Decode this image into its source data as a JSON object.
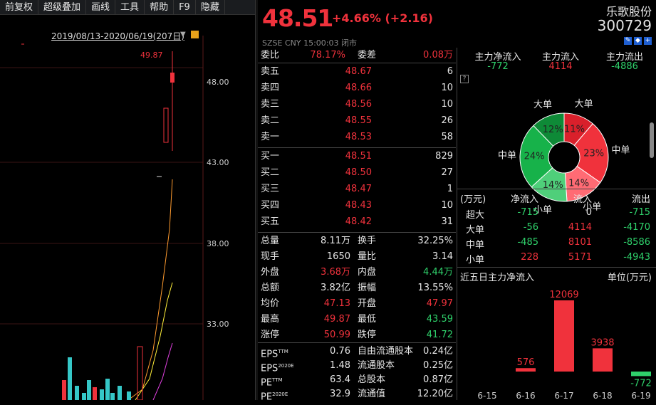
{
  "toolbar": {
    "items": [
      "前复权",
      "超级叠加",
      "画线",
      "工具",
      "帮助",
      "F9",
      "隐藏"
    ]
  },
  "kline": {
    "range": "2019/08/13-2020/06/19(207日)",
    "peak": "49.87",
    "axis": [
      "48.00",
      "43.00",
      "38.00",
      "33.00"
    ]
  },
  "header": {
    "price": "48.51",
    "change": "+4.66% (+2.16)",
    "name": "乐歌股份",
    "code": "300729",
    "sub": "SZSE  CNY  15:00:03  闭市"
  },
  "ratio": {
    "wb_label": "委比",
    "wb_value": "78.17%",
    "wc_label": "委差",
    "wc_value": "0.08万"
  },
  "asks": [
    {
      "label": "卖五",
      "price": "48.67",
      "vol": "6"
    },
    {
      "label": "卖四",
      "price": "48.66",
      "vol": "10"
    },
    {
      "label": "卖三",
      "price": "48.56",
      "vol": "10"
    },
    {
      "label": "卖二",
      "price": "48.55",
      "vol": "26"
    },
    {
      "label": "卖一",
      "price": "48.53",
      "vol": "58"
    }
  ],
  "bids": [
    {
      "label": "买一",
      "price": "48.51",
      "vol": "829"
    },
    {
      "label": "买二",
      "price": "48.50",
      "vol": "27"
    },
    {
      "label": "买三",
      "price": "48.47",
      "vol": "1"
    },
    {
      "label": "买四",
      "price": "48.43",
      "vol": "10"
    },
    {
      "label": "买五",
      "price": "48.42",
      "vol": "31"
    }
  ],
  "stats": [
    {
      "l1": "总量",
      "v1": "8.11万",
      "l2": "换手",
      "v2": "32.25%",
      "c1": "white",
      "c2": "white"
    },
    {
      "l1": "现手",
      "v1": "1650",
      "l2": "量比",
      "v2": "3.14",
      "c1": "white",
      "c2": "white"
    },
    {
      "l1": "外盘",
      "v1": "3.68万",
      "l2": "内盘",
      "v2": "4.44万",
      "c1": "red",
      "c2": "green"
    },
    {
      "l1": "总额",
      "v1": "3.82亿",
      "l2": "振幅",
      "v2": "13.55%",
      "c1": "white",
      "c2": "white"
    },
    {
      "l1": "均价",
      "v1": "47.13",
      "l2": "开盘",
      "v2": "47.97",
      "c1": "red",
      "c2": "red"
    },
    {
      "l1": "最高",
      "v1": "49.87",
      "l2": "最低",
      "v2": "43.59",
      "c1": "red",
      "c2": "green"
    },
    {
      "l1": "涨停",
      "v1": "50.99",
      "l2": "跌停",
      "v2": "41.72",
      "c1": "red",
      "c2": "green"
    }
  ],
  "fin": [
    {
      "l1": "EPS",
      "s1": "TTM",
      "v1": "0.76",
      "l2": "自由流通股本",
      "v2": "0.24亿"
    },
    {
      "l1": "EPS",
      "s1": "2020E",
      "v1": "1.48",
      "l2": "流通股本",
      "v2": "0.25亿"
    },
    {
      "l1": "PE",
      "s1": "TTM",
      "v1": "63.4",
      "l2": "总股本",
      "v2": "0.87亿"
    },
    {
      "l1": "PE",
      "s1": "2020E",
      "v1": "32.9",
      "l2": "流通值",
      "v2": "12.20亿"
    }
  ],
  "mainflow": {
    "labels": [
      "主力净流入",
      "主力流入",
      "主力流出"
    ],
    "values": [
      "-772",
      "4114",
      "-4886"
    ]
  },
  "pie": {
    "slices": [
      {
        "label": "大单",
        "pct": "11%",
        "value": 11,
        "color": "#d9202b"
      },
      {
        "label": "中单",
        "pct": "23%",
        "value": 23,
        "color": "#f0323c"
      },
      {
        "label": "小单",
        "pct": "14%",
        "value": 14,
        "color": "#ff6b74"
      },
      {
        "label": "小单",
        "pct": "14%",
        "value": 14,
        "color": "#4fcf7a"
      },
      {
        "label": "中单",
        "pct": "24%",
        "value": 24,
        "color": "#17b24a"
      },
      {
        "label": "大单",
        "pct": "12%",
        "value": 12,
        "color": "#0e8a37"
      }
    ]
  },
  "flowtable": {
    "header": [
      "(万元)",
      "净流入",
      "流入",
      "流出"
    ],
    "rows": [
      {
        "name": "超大",
        "net": "-715",
        "in": "0",
        "out": "-715"
      },
      {
        "name": "大单",
        "net": "-56",
        "in": "4114",
        "out": "-4170"
      },
      {
        "name": "中单",
        "net": "-485",
        "in": "8101",
        "out": "-8586"
      },
      {
        "name": "小单",
        "net": "228",
        "in": "5171",
        "out": "-4943"
      }
    ]
  },
  "fiveday": {
    "title": "近五日主力净流入",
    "unit": "单位(万元)"
  },
  "chart_data": {
    "type": "bar",
    "title": "近五日主力净流入",
    "categories": [
      "6-15",
      "6-16",
      "6-17",
      "6-18",
      "6-19"
    ],
    "values": [
      0,
      576,
      12069,
      3938,
      -772
    ],
    "labels": [
      "",
      "576",
      "12069",
      "3938",
      "-772"
    ]
  }
}
